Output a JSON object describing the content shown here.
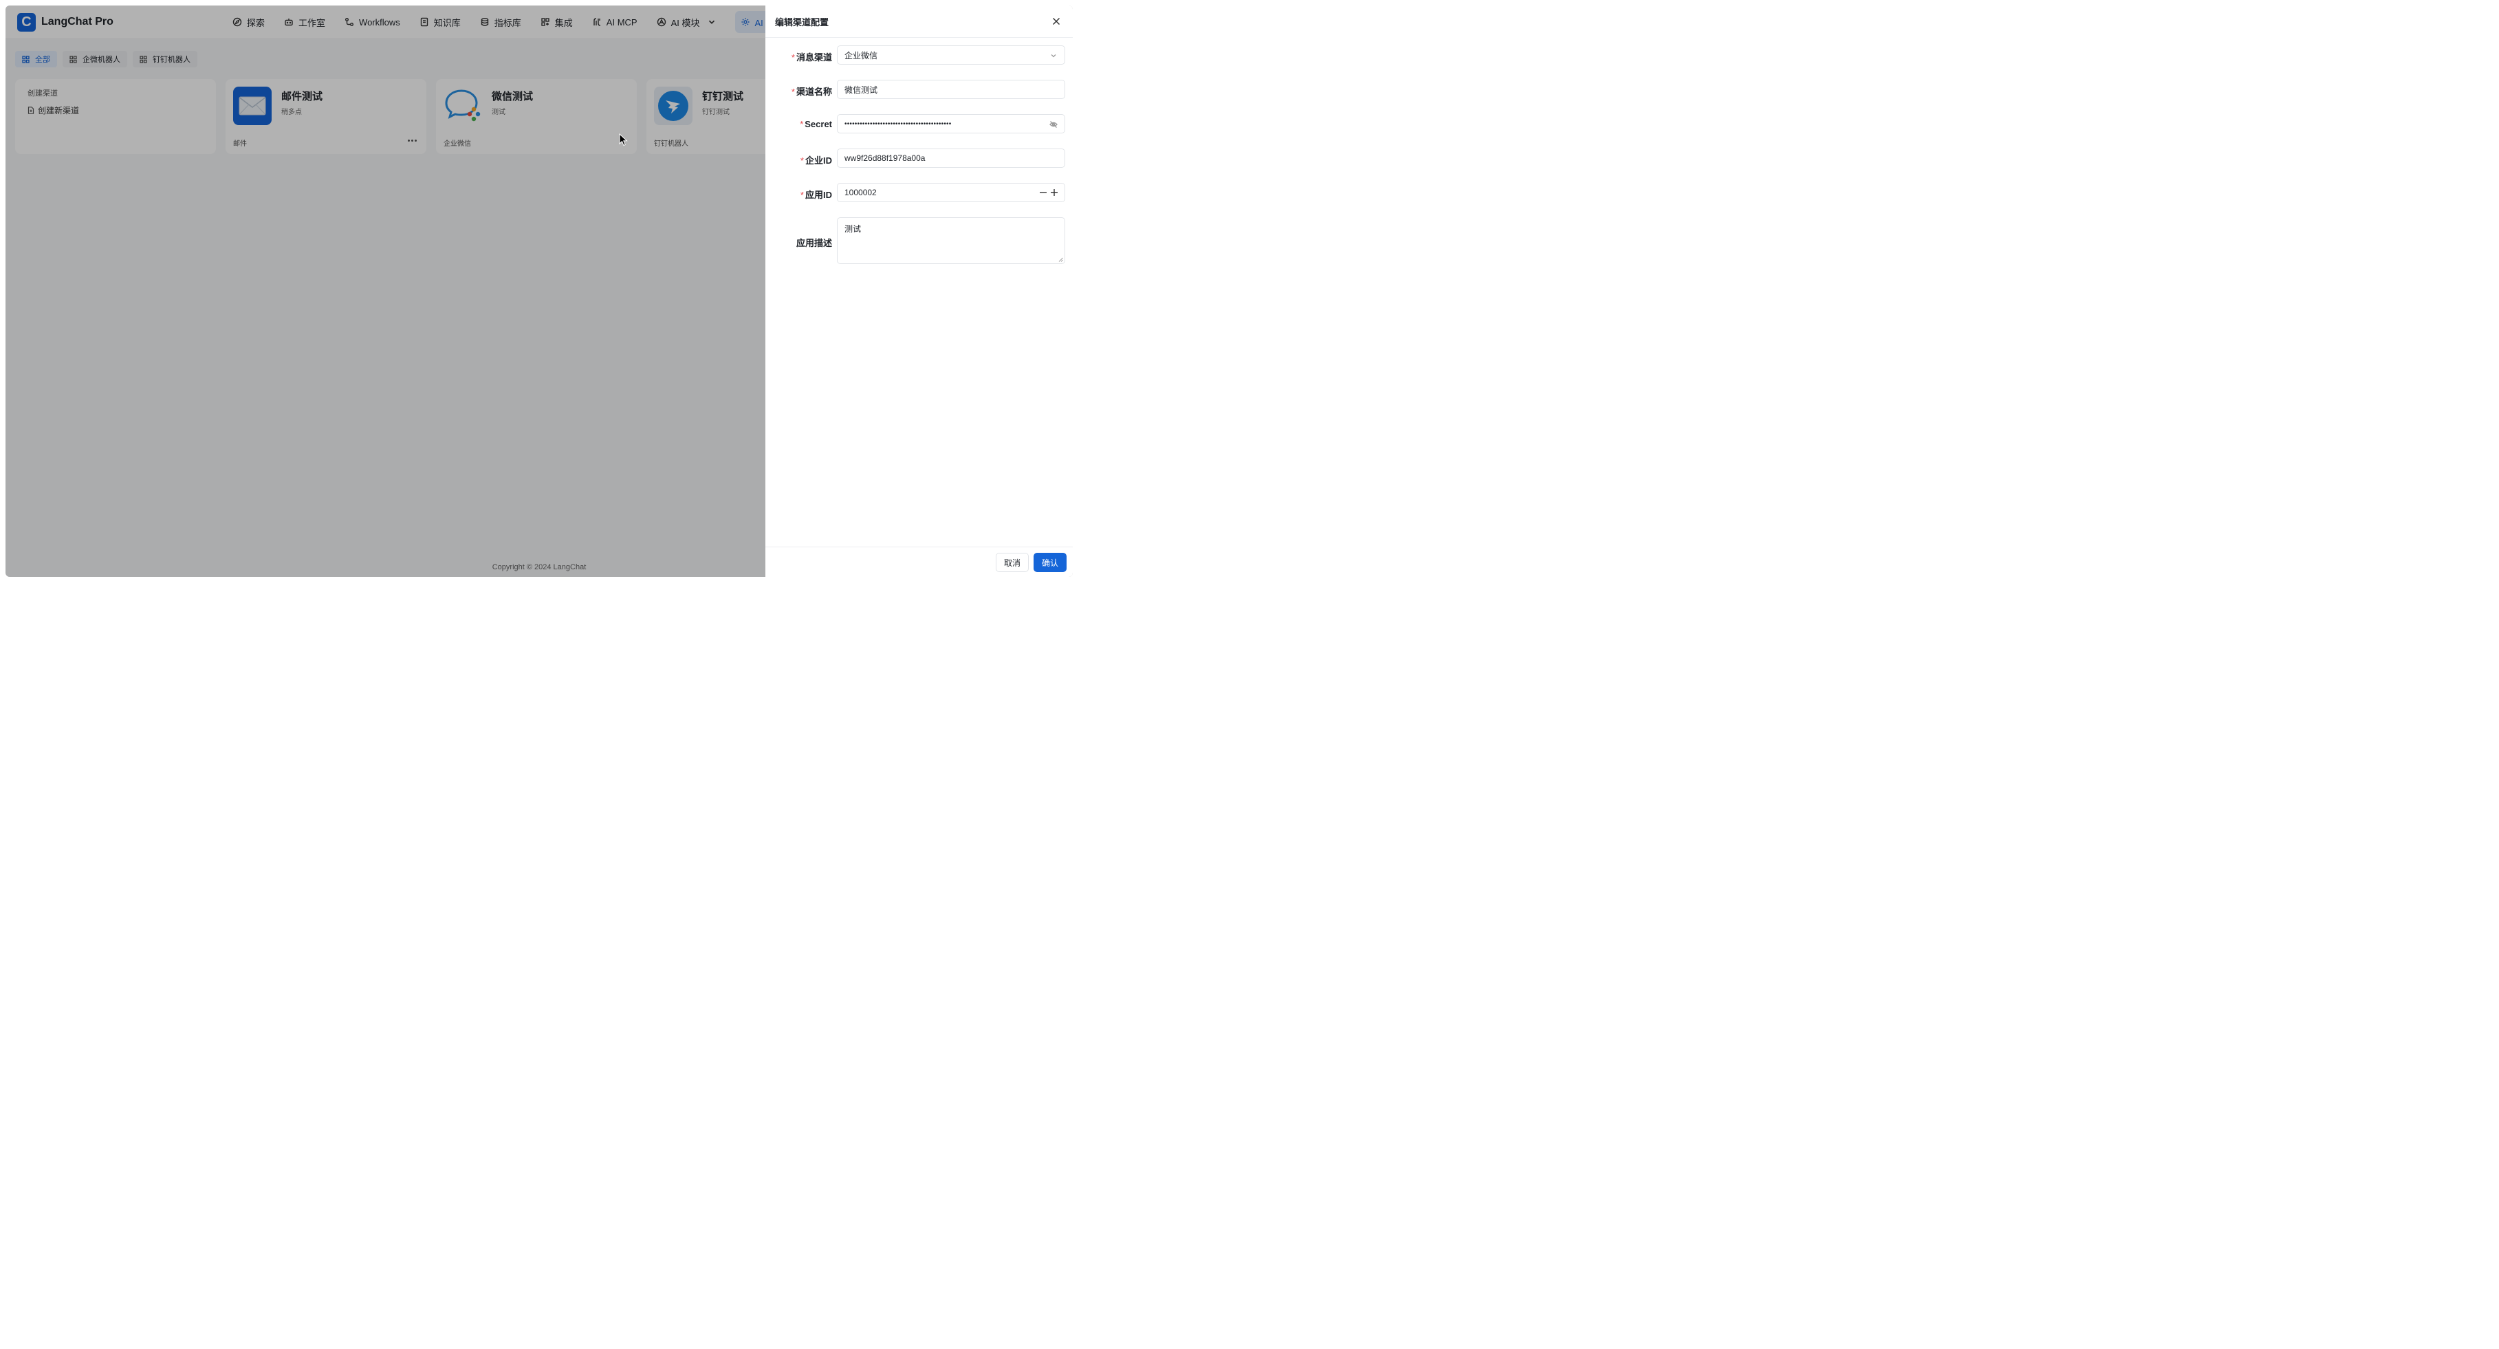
{
  "app": {
    "logo_letter": "C",
    "title": "LangChat Pro"
  },
  "nav": {
    "items": [
      {
        "label": "探索",
        "icon": "compass-icon"
      },
      {
        "label": "工作室",
        "icon": "robot-icon"
      },
      {
        "label": "Workflows",
        "icon": "workflow-icon"
      },
      {
        "label": "知识库",
        "icon": "book-icon"
      },
      {
        "label": "指标库",
        "icon": "database-icon"
      },
      {
        "label": "集成",
        "icon": "grid-plus-icon"
      },
      {
        "label": "AI MCP",
        "icon": "mcp-icon"
      },
      {
        "label": "AI 模块",
        "icon": "module-icon"
      },
      {
        "label": "AI 配置",
        "icon": "gear-icon",
        "active": true
      }
    ]
  },
  "filters": [
    {
      "label": "全部",
      "active": true
    },
    {
      "label": "企微机器人"
    },
    {
      "label": "钉钉机器人"
    }
  ],
  "create_card": {
    "title": "创建渠道",
    "link": "创建新渠道"
  },
  "channels": [
    {
      "name": "邮件测试",
      "desc": "稍多点",
      "type": "邮件",
      "icon": "mail-icon"
    },
    {
      "name": "微信测试",
      "desc": "测试",
      "type": "企业微信",
      "icon": "wecom-icon"
    },
    {
      "name": "钉钉测试",
      "desc": "钉钉测试",
      "type": "钉钉机器人",
      "icon": "dingtalk-icon"
    }
  ],
  "footer": {
    "copyright": "Copyright © 2024 LangChat"
  },
  "drawer": {
    "title": "编辑渠道配置",
    "fields": {
      "channel": {
        "label": "消息渠道",
        "value": "企业微信"
      },
      "name": {
        "label": "渠道名称",
        "value": "微信测试"
      },
      "secret": {
        "label": "Secret",
        "value": "••••••••••••••••••••••••••••••••••••••••••"
      },
      "corp_id": {
        "label": "企业ID",
        "value": "ww9f26d88f1978a00a"
      },
      "app_id": {
        "label": "应用ID",
        "value": "1000002"
      },
      "app_desc": {
        "label": "应用描述",
        "value": "测试"
      }
    },
    "cancel": "取消",
    "confirm": "确认"
  },
  "colors": {
    "accent": "#1565d8",
    "required": "#e5484d"
  }
}
